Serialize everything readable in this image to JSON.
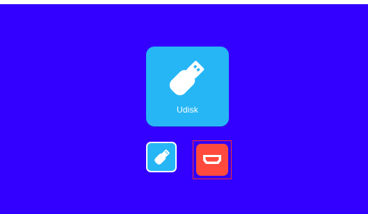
{
  "source_tile": {
    "label": "Udisk",
    "icon": "usb-drive-icon"
  },
  "source_list": [
    {
      "name": "Udisk",
      "icon": "usb-drive-icon",
      "selected": false
    },
    {
      "name": "HDMI",
      "icon": "hdmi-port-icon",
      "selected": true
    }
  ],
  "colors": {
    "background": "#3300ff",
    "usb_tile": "#26b6f5",
    "hdmi_tile": "#ff4a3d",
    "focus_border": "#ff2a2a"
  }
}
